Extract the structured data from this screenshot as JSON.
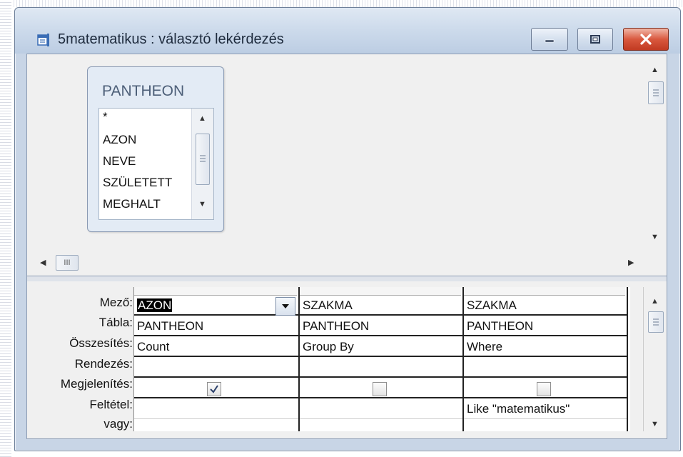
{
  "window": {
    "title": "5matematikus : választó lekérdezés",
    "controls": {
      "minimize": "minimize-icon",
      "maximize": "maximize-icon",
      "close": "close-icon"
    }
  },
  "table": {
    "name": "PANTHEON",
    "fields": [
      "*",
      "AZON",
      "NEVE",
      "SZÜLETETT",
      "MEGHALT"
    ]
  },
  "upper_hscroll": {
    "grip": "III"
  },
  "grid": {
    "row_labels": {
      "field": "Mező:",
      "table": "Tábla:",
      "total": "Összesítés:",
      "sort": "Rendezés:",
      "show": "Megjelenítés:",
      "criteria": "Feltétel:",
      "or": "vagy:"
    },
    "columns": [
      {
        "field": "AZON",
        "table": "PANTHEON",
        "total": "Count",
        "sort": "",
        "show": true,
        "criteria": ""
      },
      {
        "field": "SZAKMA",
        "table": "PANTHEON",
        "total": "Group By",
        "sort": "",
        "show": false,
        "criteria": ""
      },
      {
        "field": "SZAKMA",
        "table": "PANTHEON",
        "total": "Where",
        "sort": "",
        "show": false,
        "criteria": "Like \"matematikus\""
      }
    ]
  },
  "colors": {
    "titlebar": "#ccdaeb",
    "close_button": "#c13a21",
    "selection": "#000000"
  }
}
